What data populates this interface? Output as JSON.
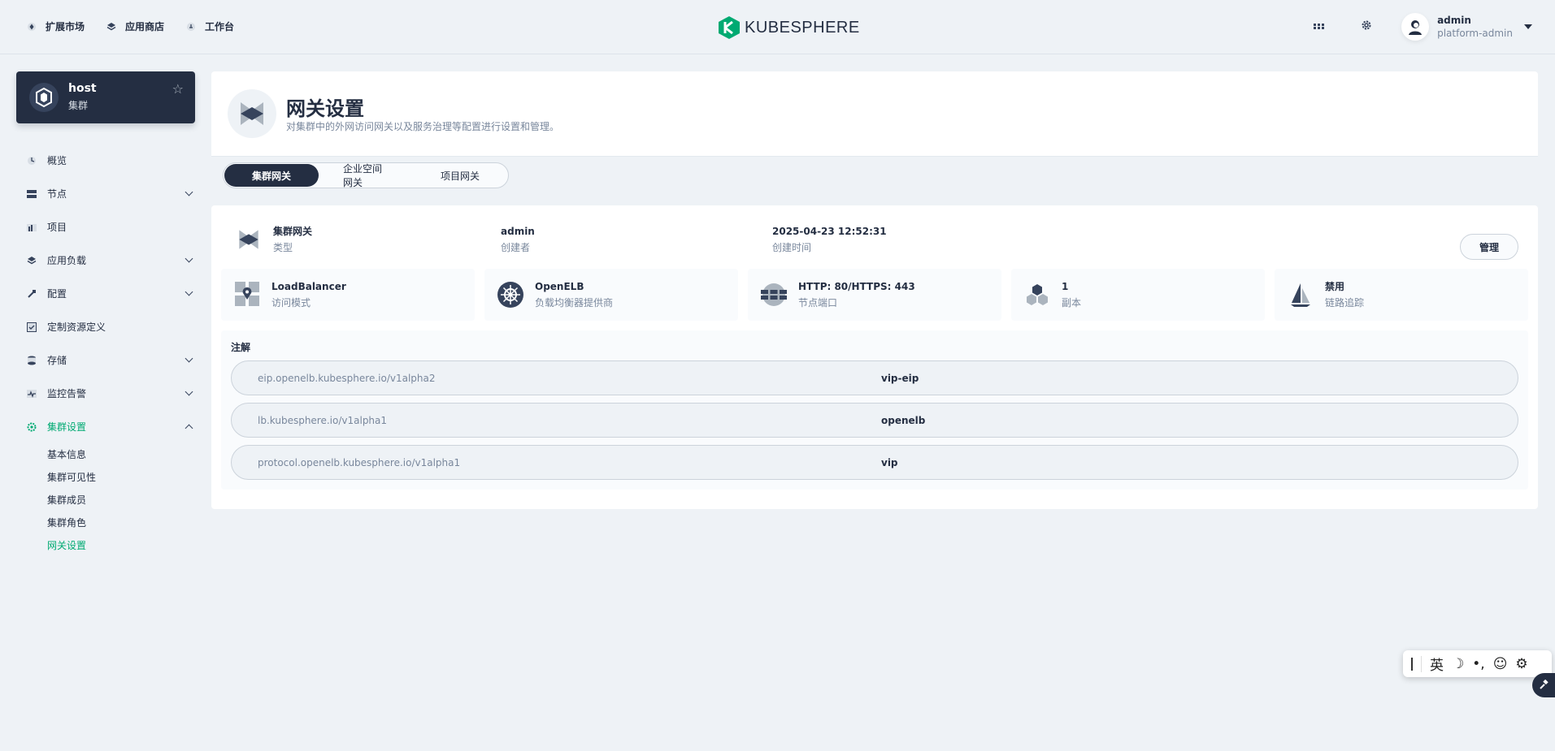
{
  "topbar": {
    "nav": [
      {
        "label": "扩展市场",
        "icon": "extensions-icon"
      },
      {
        "label": "应用商店",
        "icon": "app-store-icon"
      },
      {
        "label": "工作台",
        "icon": "workbench-icon"
      }
    ],
    "brand": "KUBESPHERE",
    "user": {
      "name": "admin",
      "role": "platform-admin"
    }
  },
  "cluster": {
    "name": "host",
    "label": "集群"
  },
  "menu": {
    "items": [
      {
        "label": "概览",
        "icon": "overview-icon",
        "expandable": false
      },
      {
        "label": "节点",
        "icon": "nodes-icon",
        "expandable": true
      },
      {
        "label": "项目",
        "icon": "projects-icon",
        "expandable": false
      },
      {
        "label": "应用负载",
        "icon": "workloads-icon",
        "expandable": true
      },
      {
        "label": "配置",
        "icon": "config-icon",
        "expandable": true
      },
      {
        "label": "定制资源定义",
        "icon": "crd-icon",
        "expandable": false
      },
      {
        "label": "存储",
        "icon": "storage-icon",
        "expandable": true
      },
      {
        "label": "监控告警",
        "icon": "monitoring-icon",
        "expandable": true
      },
      {
        "label": "集群设置",
        "icon": "cluster-settings-icon",
        "expandable": true
      }
    ],
    "submenu": [
      "基本信息",
      "集群可见性",
      "集群成员",
      "集群角色",
      "网关设置"
    ]
  },
  "page": {
    "title": "网关设置",
    "description": "对集群中的外网访问网关以及服务治理等配置进行设置和管理。",
    "tabs": [
      "集群网关",
      "企业空间网关",
      "项目网关"
    ]
  },
  "gateway": {
    "type": {
      "value": "集群网关",
      "label": "类型"
    },
    "creator": {
      "value": "admin",
      "label": "创建者"
    },
    "created": {
      "value": "2025-04-23 12:52:31",
      "label": "创建时间"
    },
    "manage_label": "管理",
    "stats": [
      {
        "value": "LoadBalancer",
        "label": "访问模式",
        "icon": "access-mode-icon"
      },
      {
        "value": "OpenELB",
        "label": "负载均衡器提供商",
        "icon": "helm-icon"
      },
      {
        "value": "HTTP: 80/HTTPS: 443",
        "label": "节点端口",
        "icon": "globe-icon"
      },
      {
        "value": "1",
        "label": "副本",
        "icon": "replicas-icon"
      },
      {
        "value": "禁用",
        "label": "链路追踪",
        "icon": "tracing-icon"
      }
    ],
    "annotations_title": "注解",
    "annotations": [
      {
        "key": "eip.openelb.kubesphere.io/v1alpha2",
        "value": "vip-eip"
      },
      {
        "key": "lb.kubesphere.io/v1alpha1",
        "value": "openelb"
      },
      {
        "key": "protocol.openelb.kubesphere.io/v1alpha1",
        "value": "vip"
      }
    ]
  },
  "ime": {
    "lang": "英"
  },
  "colors": {
    "primary_dark": "#242e42",
    "accent_green": "#00aa72",
    "bg": "#eef2f6"
  }
}
